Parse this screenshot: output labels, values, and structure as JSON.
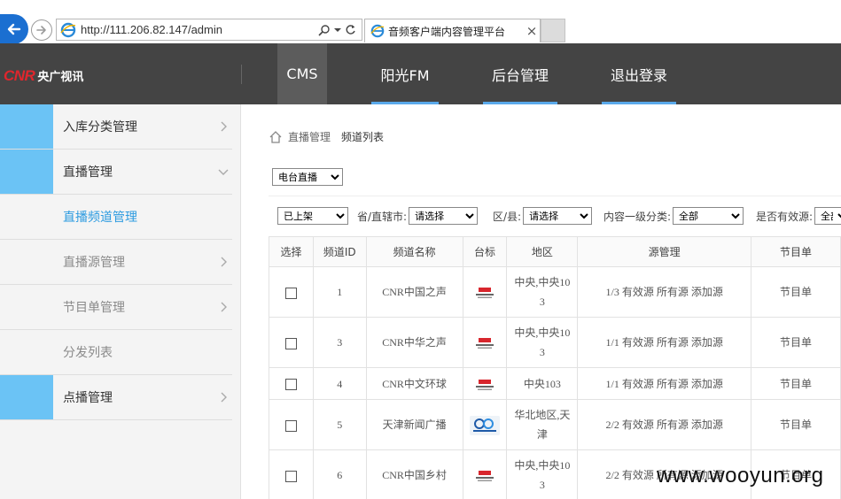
{
  "browser": {
    "url": "http://111.206.82.147/admin",
    "tab_title": "音频客户端内容管理平台",
    "tab_close": "×"
  },
  "brand": {
    "logo_text": "CNR",
    "name": "央广视讯",
    "accent": "#e0262d"
  },
  "topnav": [
    {
      "label": "CMS",
      "active": true
    },
    {
      "label": "阳光FM"
    },
    {
      "label": "后台管理"
    },
    {
      "label": "退出登录"
    }
  ],
  "sidebar": [
    {
      "label": "入库分类管理"
    },
    {
      "label": "直播管理"
    },
    {
      "label": "直播频道管理"
    },
    {
      "label": "直播源管理"
    },
    {
      "label": "节目单管理"
    },
    {
      "label": "分发列表"
    },
    {
      "label": "点播管理"
    }
  ],
  "breadcrumb": {
    "parent": "直播管理",
    "current": "频道列表"
  },
  "type_select": {
    "value": "电台直播"
  },
  "filters": {
    "status": {
      "value": "已上架"
    },
    "province": {
      "label": "省/直辖市:",
      "value": "请选择"
    },
    "district": {
      "label": "区/县:",
      "value": "请选择"
    },
    "category": {
      "label": "内容一级分类:",
      "value": "全部"
    },
    "valid": {
      "label": "是否有效源:",
      "value": "全部"
    }
  },
  "table": {
    "headers": [
      "选择",
      "频道ID",
      "频道名称",
      "台标",
      "地区",
      "源管理",
      "节目单"
    ],
    "rows": [
      {
        "id": "1",
        "name": "CNR中国之声",
        "region_line1": "中央,中央10",
        "region_line2": "3",
        "source": "1/3 有效源 所有源 添加源",
        "schedule": "节目单"
      },
      {
        "id": "3",
        "name": "CNR中华之声",
        "region_line1": "中央,中央10",
        "region_line2": "3",
        "source": "1/1 有效源 所有源 添加源",
        "schedule": "节目单"
      },
      {
        "id": "4",
        "name": "CNR中文环球",
        "region_line1": "中央103",
        "region_line2": "",
        "source": "1/1 有效源 所有源 添加源",
        "schedule": "节目单"
      },
      {
        "id": "5",
        "name": "天津新闻广播",
        "region_line1": "华北地区,天",
        "region_line2": "津",
        "source": "2/2 有效源 所有源 添加源",
        "schedule": "节目单"
      },
      {
        "id": "6",
        "name": "CNR中国乡村",
        "region_line1": "中央,中央10",
        "region_line2": "3",
        "source": "2/2 有效源 所有源 添加源",
        "schedule": "节目单"
      }
    ]
  },
  "watermark": "www.wooyun.org"
}
